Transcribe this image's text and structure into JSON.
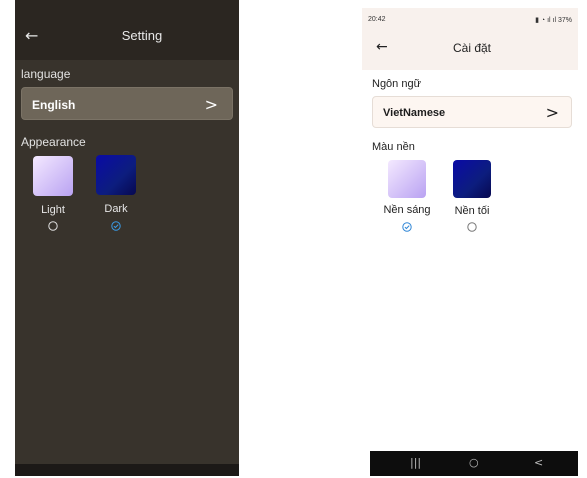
{
  "left_screen": {
    "header": {
      "back_icon": "arrow-left-icon",
      "title": "Setting"
    },
    "language_section": {
      "label": "language",
      "selected_value": "English",
      "chevron_icon": "chevron-right-icon"
    },
    "appearance_section": {
      "label": "Appearance",
      "options": [
        {
          "label": "Light",
          "selected": false
        },
        {
          "label": "Dark",
          "selected": true
        }
      ]
    }
  },
  "right_screen": {
    "status_bar": {
      "time": "20:42",
      "battery": "37%"
    },
    "header": {
      "back_icon": "arrow-left-icon",
      "title": "Cài đặt"
    },
    "language_section": {
      "label": "Ngôn ngữ",
      "selected_value": "VietNamese",
      "chevron_icon": "chevron-right-icon"
    },
    "appearance_section": {
      "label": "Màu nền",
      "options": [
        {
          "label": "Nền sáng",
          "selected": true
        },
        {
          "label": "Nền tối",
          "selected": false
        }
      ]
    },
    "nav_bar": {
      "recents": "|||",
      "home": "○",
      "back": "<"
    }
  },
  "colors": {
    "dark_bg": "#38332c",
    "dark_header": "#2b2621",
    "dark_button": "#6e6659",
    "light_header": "#f8f1ed",
    "radio_selected": "#2f86d6"
  }
}
